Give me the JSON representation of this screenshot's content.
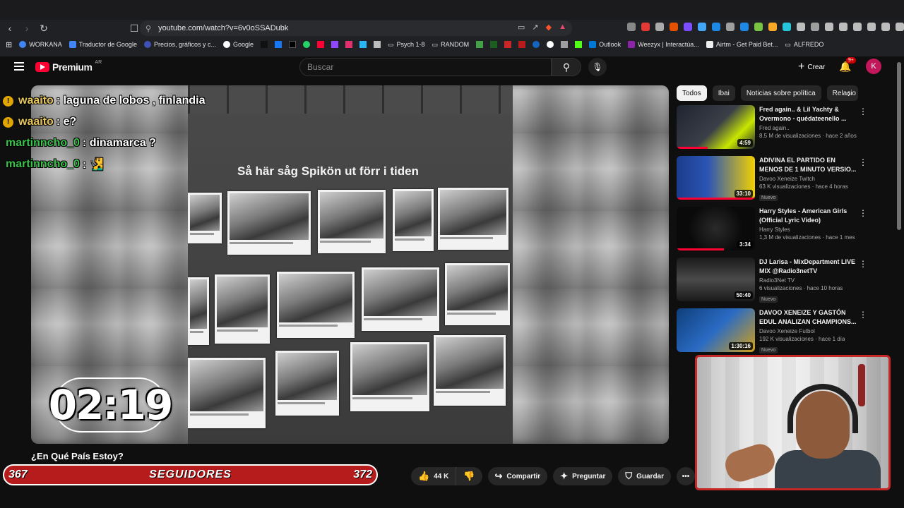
{
  "browser": {
    "url": "youtube.com/watch?v=6v0oSSADubk",
    "bookmarks": [
      "WORKANA",
      "Traductor de Google",
      "Precios, gráficos y c...",
      "Google",
      "Psych 1-8",
      "RANDOM",
      "Outlook",
      "Weezyx | Interactúa...",
      "Airtm - Get Paid Bet...",
      "ALFREDO"
    ]
  },
  "yt_header": {
    "logo_text": "Premium",
    "region": "AR",
    "search_placeholder": "Buscar",
    "create_label": "Crear",
    "notif_count": "9+",
    "avatar_letter": "K"
  },
  "player": {
    "board_title": "Så här såg Spikön ut förr i tiden",
    "timer": "02:19"
  },
  "chat": [
    {
      "user": "waaito",
      "msg": ": laguna de lobos , finlandia",
      "color": "#e8c65a",
      "badge": true
    },
    {
      "user": "waaito",
      "msg": ": e?",
      "color": "#e8c65a",
      "badge": true
    },
    {
      "user": "martinncho_0",
      "msg": ": dinamarca ?",
      "color": "#38c34a",
      "badge": false
    },
    {
      "user": "martinncho_0",
      "msg": ": 🧏‍♂️",
      "color": "#38c34a",
      "badge": false
    }
  ],
  "video": {
    "title": "¿En Qué País Estoy?",
    "likes": "44 K",
    "share": "Compartir",
    "ask": "Preguntar",
    "save": "Guardar"
  },
  "followers_bar": {
    "current": "367",
    "label": "SEGUIDORES",
    "goal": "372"
  },
  "chips": [
    "Todos",
    "Ibai",
    "Noticias sobre política",
    "Relacio"
  ],
  "recommendations": [
    {
      "title": "Fred again.. & Lil Yachty & Overmono - quédateenello ...",
      "channel": "Fred again..",
      "meta": "8,5 M de visualizaciones · hace 2 años",
      "duration": "4:59",
      "badge": "",
      "colors": [
        "#1e2430",
        "#c8e600"
      ],
      "progress": 0.4
    },
    {
      "title": "ADIVINA EL PARTIDO EN MENOS DE 1 MINUTO VERSIO...",
      "channel": "Davoo Xeneize Twitch",
      "meta": "63 K visualizaciones · hace 4 horas",
      "duration": "33:10",
      "badge": "Nuevo",
      "colors": [
        "#1c3b8a",
        "#f2d100"
      ],
      "progress": 1.0
    },
    {
      "title": "Harry Styles - American Girls (Official Lyric Video)",
      "channel": "Harry Styles",
      "meta": "1,3 M de visualizaciones · hace 1 mes",
      "duration": "3:34",
      "badge": "",
      "colors": [
        "#0a0a0a",
        "#2a2a2a"
      ],
      "progress": 0.6
    },
    {
      "title": "DJ Larisa - MixDepartment LIVE MIX @Radio3netTV",
      "channel": "Radio3Net TV",
      "meta": "6 visualizaciones · hace 10 horas",
      "duration": "50:40",
      "badge": "Nuevo",
      "colors": [
        "#1a1a1a",
        "#4a4a4a"
      ],
      "progress": 0
    },
    {
      "title": "DAVOO XENEIZE Y GASTÓN EDUL ANALIZAN CHAMPIONS...",
      "channel": "Davoo Xeneize Futbol",
      "meta": "192 K visualizaciones · hace 1 día",
      "duration": "1:30:16",
      "badge": "Nuevo",
      "colors": [
        "#0f3f7a",
        "#d4a017"
      ],
      "progress": 0
    }
  ]
}
